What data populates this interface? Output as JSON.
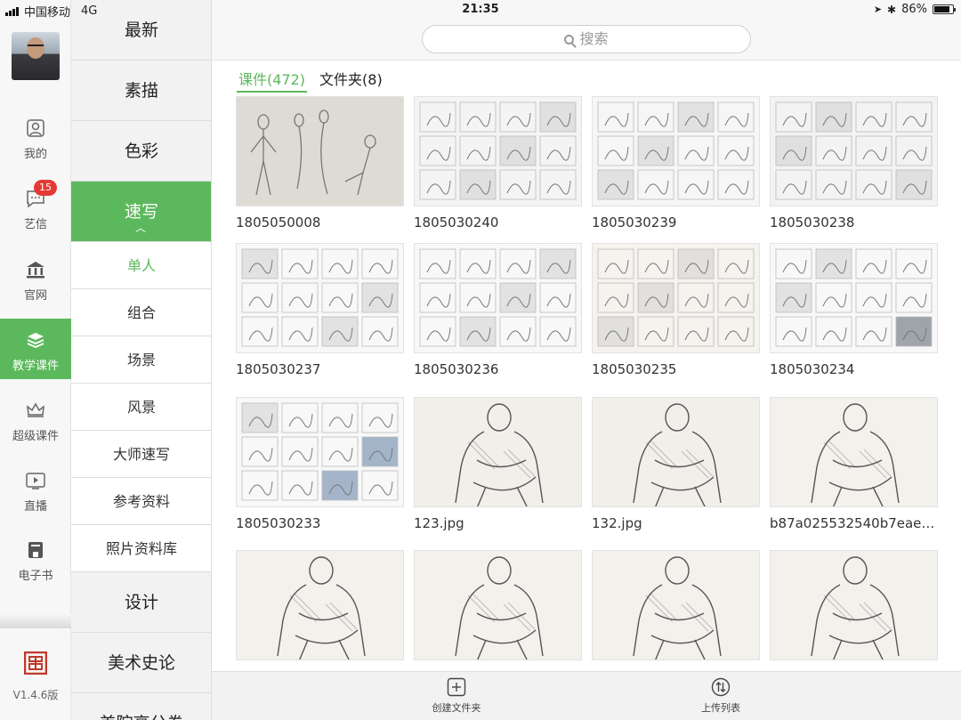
{
  "status": {
    "carrier": "中国移动",
    "network": "4G",
    "time": "21:35",
    "battery": "86%",
    "battery_level": 0.86
  },
  "rail": {
    "items": [
      {
        "label": "我的",
        "icon": "person-icon"
      },
      {
        "label": "艺信",
        "icon": "chat-icon",
        "badge": "15"
      },
      {
        "label": "官网",
        "icon": "bank-icon"
      },
      {
        "label": "教学课件",
        "icon": "books-icon",
        "active": true
      },
      {
        "label": "超级课件",
        "icon": "crown-icon"
      },
      {
        "label": "直播",
        "icon": "tv-play-icon"
      },
      {
        "label": "电子书",
        "icon": "ebook-icon"
      }
    ],
    "version": "V1.4.6版"
  },
  "categories": {
    "main_top": [
      "最新",
      "素描",
      "色彩"
    ],
    "active_main": "速写",
    "subs": [
      "单人",
      "组合",
      "场景",
      "风景",
      "大师速写",
      "参考资料",
      "照片资料库"
    ],
    "active_sub": "单人",
    "main_bottom": [
      "设计",
      "美术史论",
      "美院高分卷"
    ]
  },
  "main": {
    "search_placeholder": "搜索",
    "tabs": [
      {
        "label": "课件(472)",
        "active": true
      },
      {
        "label": "文件夹(8)",
        "active": false
      }
    ],
    "tiles": [
      "1805050008",
      "1805030240",
      "1805030239",
      "1805030238",
      "1805030237",
      "1805030236",
      "1805030235",
      "1805030234",
      "1805030233",
      "123.jpg",
      "132.jpg",
      "b87a025532540b7eae2...",
      "",
      "",
      "",
      ""
    ],
    "bottom": {
      "create_folder": "创建文件夹",
      "upload_list": "上传列表"
    }
  },
  "colors": {
    "accent": "#5cb85c",
    "badge": "#e53935"
  }
}
